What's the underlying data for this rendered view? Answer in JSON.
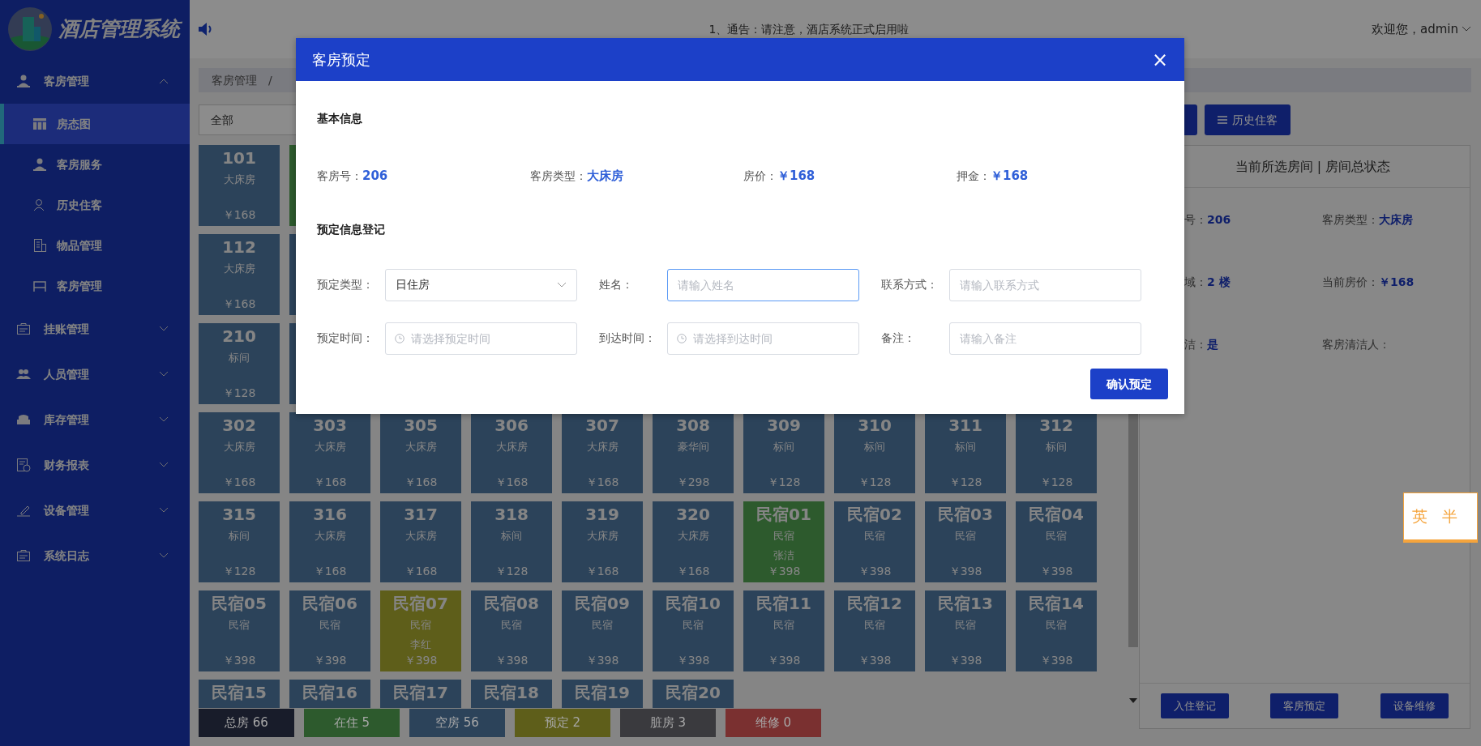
{
  "app": {
    "title": "酒店管理系统"
  },
  "sidebar": {
    "items": [
      {
        "label": "客房管理",
        "expanded": true,
        "children": [
          {
            "label": "房态图",
            "selected": true
          },
          {
            "label": "客房服务",
            "selected": false
          },
          {
            "label": "历史住客",
            "selected": false
          },
          {
            "label": "物品管理",
            "selected": false
          },
          {
            "label": "客房管理",
            "selected": false
          }
        ]
      },
      {
        "label": "挂账管理",
        "expanded": false
      },
      {
        "label": "人员管理",
        "expanded": false
      },
      {
        "label": "库存管理",
        "expanded": false
      },
      {
        "label": "财务报表",
        "expanded": false
      },
      {
        "label": "设备管理",
        "expanded": false
      },
      {
        "label": "系统日志",
        "expanded": false
      }
    ]
  },
  "header": {
    "notice": "1、通告：请注意，酒店系统正式启用啦",
    "user": "欢迎您，admin"
  },
  "breadcrumb": {
    "items": [
      "客房管理"
    ],
    "separator": "/"
  },
  "filter": {
    "value": "全部"
  },
  "toolbar": {
    "buttons": [
      {
        "label": "历史住客"
      }
    ]
  },
  "room_rows": [
    [
      {
        "kind": "vacant",
        "number": "101",
        "type": "大床房",
        "price": "￥168"
      },
      {
        "kind": "occupied"
      }
    ],
    [
      {
        "kind": "vacant",
        "number": "112",
        "type": "大床房",
        "price": "￥168"
      },
      {
        "kind": "vacant"
      }
    ],
    [
      {
        "kind": "vacant",
        "number": "210",
        "type": "标间",
        "price": "￥128"
      },
      {
        "kind": "vacant"
      }
    ],
    [
      {
        "kind": "vacant",
        "number": "302",
        "type": "大床房",
        "price": "￥168"
      },
      {
        "kind": "vacant",
        "number": "303",
        "type": "大床房",
        "price": "￥168"
      },
      {
        "kind": "vacant",
        "number": "305",
        "type": "大床房",
        "price": "￥168"
      },
      {
        "kind": "vacant",
        "number": "306",
        "type": "大床房",
        "price": "￥168"
      },
      {
        "kind": "vacant",
        "number": "307",
        "type": "大床房",
        "price": "￥168"
      },
      {
        "kind": "vacant",
        "number": "308",
        "type": "豪华间",
        "price": "￥298"
      },
      {
        "kind": "vacant",
        "number": "309",
        "type": "标间",
        "price": "￥128"
      },
      {
        "kind": "vacant",
        "number": "310",
        "type": "标间",
        "price": "￥128"
      },
      {
        "kind": "vacant",
        "number": "311",
        "type": "标间",
        "price": "￥128"
      },
      {
        "kind": "vacant",
        "number": "312",
        "type": "标间",
        "price": "￥128"
      }
    ],
    [
      {
        "kind": "vacant",
        "number": "315",
        "type": "标间",
        "price": "￥128"
      },
      {
        "kind": "vacant",
        "number": "316",
        "type": "大床房",
        "price": "￥168"
      },
      {
        "kind": "vacant",
        "number": "317",
        "type": "大床房",
        "price": "￥168"
      },
      {
        "kind": "vacant",
        "number": "318",
        "type": "标间",
        "price": "￥128"
      },
      {
        "kind": "vacant",
        "number": "319",
        "type": "大床房",
        "price": "￥168"
      },
      {
        "kind": "vacant",
        "number": "320",
        "type": "大床房",
        "price": "￥168"
      },
      {
        "kind": "occupied",
        "number": "民宿01",
        "type": "民宿",
        "guest": "张洁",
        "price": "￥398"
      },
      {
        "kind": "vacant",
        "number": "民宿02",
        "type": "民宿",
        "price": "￥398"
      },
      {
        "kind": "vacant",
        "number": "民宿03",
        "type": "民宿",
        "price": "￥398"
      },
      {
        "kind": "vacant",
        "number": "民宿04",
        "type": "民宿",
        "price": "￥398"
      }
    ],
    [
      {
        "kind": "vacant",
        "number": "民宿05",
        "type": "民宿",
        "price": "￥398"
      },
      {
        "kind": "vacant",
        "number": "民宿06",
        "type": "民宿",
        "price": "￥398"
      },
      {
        "kind": "reserved",
        "number": "民宿07",
        "type": "民宿",
        "guest": "李红",
        "price": "￥398"
      },
      {
        "kind": "vacant",
        "number": "民宿08",
        "type": "民宿",
        "price": "￥398"
      },
      {
        "kind": "vacant",
        "number": "民宿09",
        "type": "民宿",
        "price": "￥398"
      },
      {
        "kind": "vacant",
        "number": "民宿10",
        "type": "民宿",
        "price": "￥398"
      },
      {
        "kind": "vacant",
        "number": "民宿11",
        "type": "民宿",
        "price": "￥398"
      },
      {
        "kind": "vacant",
        "number": "民宿12",
        "type": "民宿",
        "price": "￥398"
      },
      {
        "kind": "vacant",
        "number": "民宿13",
        "type": "民宿",
        "price": "￥398"
      },
      {
        "kind": "vacant",
        "number": "民宿14",
        "type": "民宿",
        "price": "￥398"
      }
    ],
    [
      {
        "kind": "vacant",
        "number": "民宿15"
      },
      {
        "kind": "vacant",
        "number": "民宿16"
      },
      {
        "kind": "vacant",
        "number": "民宿17"
      },
      {
        "kind": "vacant",
        "number": "民宿18"
      },
      {
        "kind": "vacant",
        "number": "民宿19"
      },
      {
        "kind": "vacant",
        "number": "民宿20"
      }
    ]
  ],
  "legend": [
    {
      "label": "总房 66",
      "color": "#181c2a"
    },
    {
      "label": "在住 5",
      "color": "#2d5a2d"
    },
    {
      "label": "空房 56",
      "color": "#2c435a"
    },
    {
      "label": "预定 2",
      "color": "#5e5e1a"
    },
    {
      "label": "脏房 3",
      "color": "#3a3a3e"
    },
    {
      "label": "维修 0",
      "color": "#7a3030"
    }
  ],
  "panel": {
    "title": "当前所选房间 | 房间总状态",
    "fields": [
      {
        "label": "号：",
        "value": "206"
      },
      {
        "label": "客房类型：",
        "value": "大床房"
      },
      {
        "label": "域：",
        "value": "2 楼"
      },
      {
        "label": "当前房价：",
        "value": "￥168"
      },
      {
        "label": "洁：",
        "value": "是"
      },
      {
        "label": "客房清洁人："
      }
    ],
    "buttons": [
      "入住登记",
      "客房预定",
      "设备维修"
    ]
  },
  "modal": {
    "title": "客房预定",
    "close": "×",
    "basic_title": "基本信息",
    "basic": [
      {
        "label": "客房号：",
        "value": "206"
      },
      {
        "label": "客房类型：",
        "value": "大床房"
      },
      {
        "label": "房价：",
        "value": "￥168"
      },
      {
        "label": "押金：",
        "value": "￥168"
      }
    ],
    "form_title": "预定信息登记",
    "fields": [
      {
        "kind": "select",
        "label": "预定类型：",
        "value": "日住房",
        "focused": false
      },
      {
        "kind": "text",
        "label": "姓名：",
        "placeholder": "请输入姓名",
        "focused": true
      },
      {
        "kind": "text",
        "label": "联系方式：",
        "placeholder": "请输入联系方式",
        "focused": false
      },
      {
        "kind": "datetime",
        "label": "预定时间：",
        "placeholder": "请选择预定时间",
        "focused": false
      },
      {
        "kind": "datetime",
        "label": "到达时间：",
        "placeholder": "请选择到达时间",
        "focused": false
      },
      {
        "kind": "text",
        "label": "备注：",
        "placeholder": "请输入备注",
        "focused": false
      }
    ],
    "submit": "确认预定"
  },
  "ime": {
    "mode": "英",
    "width": "半"
  }
}
